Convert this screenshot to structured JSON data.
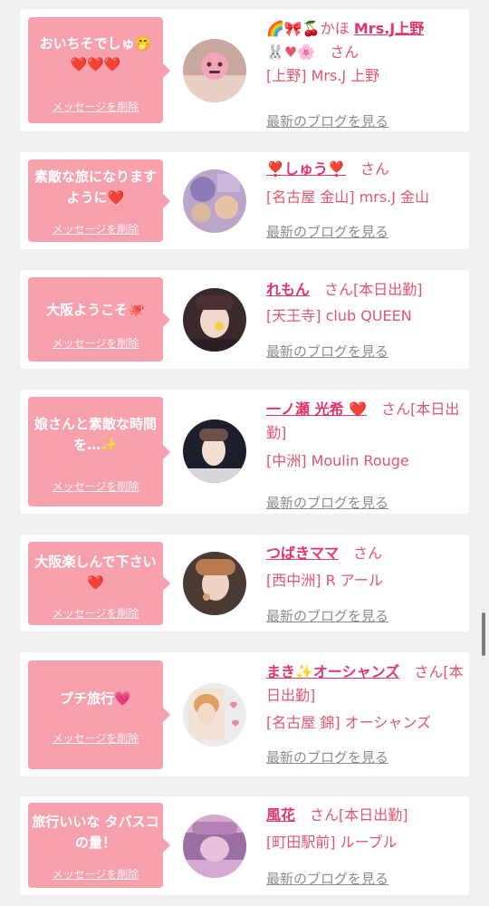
{
  "delete_label": "メッセージを削除",
  "blog_label": "最新のブログを見る",
  "san": "さん",
  "colors": {
    "bubble": "#f7a0ae",
    "name": "#e3356a",
    "text": "#e3556f",
    "link_gray": "#8c8c8c",
    "background": "#f1f1f1"
  },
  "entries": [
    {
      "message": "おいちそでしゅ🤭❤️❤️❤️",
      "name_prefix": "🌈🎀🍒かほ",
      "name": "Mrs.J上野",
      "name_suffix": "🐰♥🌸",
      "status": "",
      "shop": "[上野] Mrs.J 上野"
    },
    {
      "message": "素敵な旅になりますように❤️",
      "name_prefix": "",
      "name": "❣️しゅう❣️",
      "name_suffix": "",
      "status": "",
      "shop": "[名古屋 金山] mrs.J 金山"
    },
    {
      "message": "大阪ようこそ🐙",
      "name_prefix": "",
      "name": "れもん",
      "name_suffix": "",
      "status": "[本日出勤]",
      "shop": "[天王寺] club QUEEN"
    },
    {
      "message": "娘さんと素敵な時間を…✨",
      "name_prefix": "",
      "name": "一ノ瀬 光希 ❤️",
      "name_suffix": "",
      "status": "[本日出勤]",
      "shop": "[中洲] Moulin Rouge"
    },
    {
      "message": "大阪楽しんで下さい❤️",
      "name_prefix": "",
      "name": "つばきママ",
      "name_suffix": "",
      "status": "",
      "shop": "[西中洲] R アール"
    },
    {
      "message": "プチ旅行💗",
      "name_prefix": "",
      "name": "まき✨オーシャンズ",
      "name_suffix": "",
      "status": "[本日出勤]",
      "shop": "[名古屋 錦] オーシャンズ"
    },
    {
      "message": "旅行いいな タバスコの量！",
      "name_prefix": "",
      "name": "風花",
      "name_suffix": "",
      "status": "[本日出勤]",
      "shop": "[町田駅前] ルーブル"
    }
  ]
}
